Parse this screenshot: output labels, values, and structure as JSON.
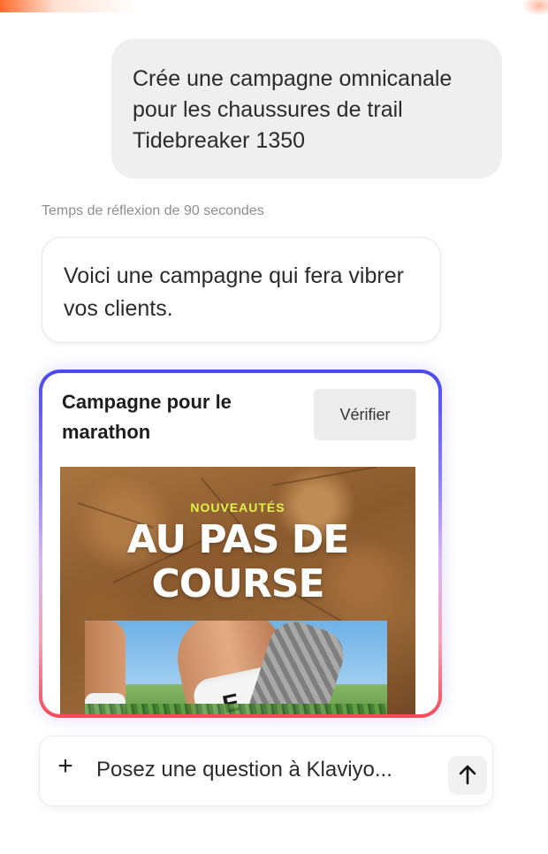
{
  "conversation": {
    "user_message": "Crée une campagne omnicanale pour les chaussures de trail Tidebreaker 1350",
    "reasoning_note": "Temps de réflexion de 90 secondes",
    "assistant_message": "Voici une campagne qui fera vibrer vos clients."
  },
  "campaign_card": {
    "title": "Campagne pour le marathon",
    "verify_label": "Vérifier",
    "hero": {
      "eyebrow": "NOUVEAUTÉS",
      "headline": "AU PAS DE COURSE"
    }
  },
  "composer": {
    "placeholder": "Posez une question à Klaviyo...",
    "plus_icon": "plus-icon",
    "send_icon": "arrow-up-icon"
  },
  "colors": {
    "accent_eyebrow": "#e0f14a",
    "card_gradient_top": "#4c48f0",
    "card_gradient_bottom": "#f24b58"
  }
}
